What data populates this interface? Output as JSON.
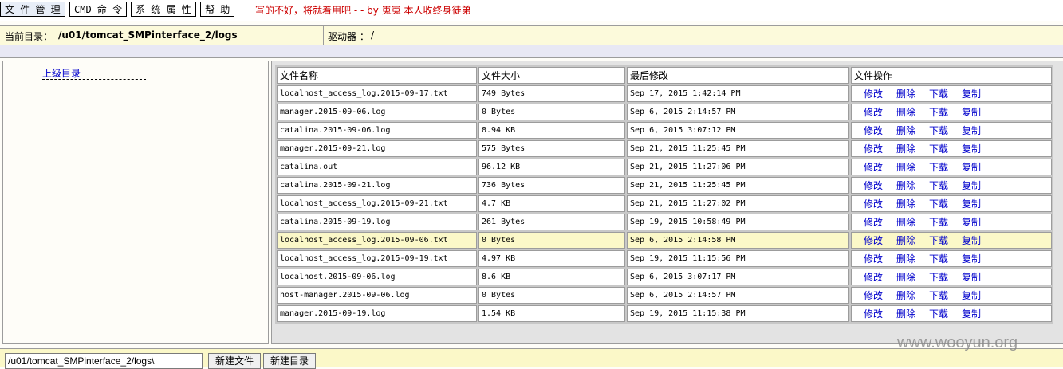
{
  "menu": {
    "items": [
      "文 件 管 理",
      "CMD 命 令",
      "系 统 属 性",
      "帮 助"
    ],
    "notice": "写的不好，将就着用吧 - - by 嵬嵬 本人收终身徒弟"
  },
  "pathbar": {
    "current_label": "当前目录：",
    "current_path": "/u01/tomcat_SMPinterface_2/logs",
    "drive_label": "驱动器 ：",
    "drive_value": "/"
  },
  "sidebar": {
    "parent_dir": "上级目录"
  },
  "table": {
    "headers": [
      "文件名称",
      "文件大小",
      "最后修改",
      "文件操作"
    ],
    "ops": [
      "修改",
      "删除",
      "下载",
      "复制"
    ],
    "rows": [
      {
        "name": "localhost_access_log.2015-09-17.txt",
        "size": "749 Bytes",
        "modified": "Sep 17, 2015 1:42:14 PM"
      },
      {
        "name": "manager.2015-09-06.log",
        "size": "0 Bytes",
        "modified": "Sep 6, 2015 2:14:57 PM"
      },
      {
        "name": "catalina.2015-09-06.log",
        "size": "8.94 KB",
        "modified": "Sep 6, 2015 3:07:12 PM"
      },
      {
        "name": "manager.2015-09-21.log",
        "size": "575 Bytes",
        "modified": "Sep 21, 2015 11:25:45 PM"
      },
      {
        "name": "catalina.out",
        "size": "96.12 KB",
        "modified": "Sep 21, 2015 11:27:06 PM"
      },
      {
        "name": "catalina.2015-09-21.log",
        "size": "736 Bytes",
        "modified": "Sep 21, 2015 11:25:45 PM"
      },
      {
        "name": "localhost_access_log.2015-09-21.txt",
        "size": "4.7 KB",
        "modified": "Sep 21, 2015 11:27:02 PM"
      },
      {
        "name": "catalina.2015-09-19.log",
        "size": "261 Bytes",
        "modified": "Sep 19, 2015 10:58:49 PM"
      },
      {
        "name": "localhost_access_log.2015-09-06.txt",
        "size": "0 Bytes",
        "modified": "Sep 6, 2015 2:14:58 PM"
      },
      {
        "name": "localhost_access_log.2015-09-19.txt",
        "size": "4.97 KB",
        "modified": "Sep 19, 2015 11:15:56 PM"
      },
      {
        "name": "localhost.2015-09-06.log",
        "size": "8.6 KB",
        "modified": "Sep 6, 2015 3:07:17 PM"
      },
      {
        "name": "host-manager.2015-09-06.log",
        "size": "0 Bytes",
        "modified": "Sep 6, 2015 2:14:57 PM"
      },
      {
        "name": "manager.2015-09-19.log",
        "size": "1.54 KB",
        "modified": "Sep 19, 2015 11:15:38 PM"
      }
    ],
    "highlighted_row": 8
  },
  "bottom": {
    "path_input_value": "/u01/tomcat_SMPinterface_2/logs\\",
    "new_file_label": "新建文件",
    "new_dir_label": "新建目录"
  },
  "watermark": "www.wooyun.org"
}
